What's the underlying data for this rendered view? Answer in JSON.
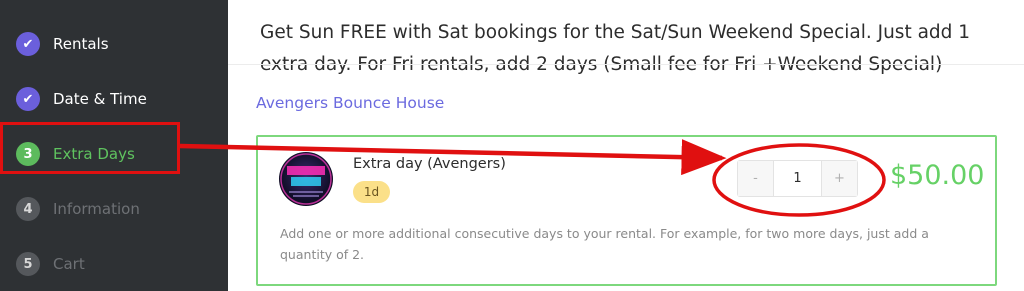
{
  "sidebar": {
    "steps": [
      {
        "number": "✔",
        "label": "Rentals",
        "state": "done"
      },
      {
        "number": "✔",
        "label": "Date & Time",
        "state": "done"
      },
      {
        "number": "3",
        "label": "Extra Days",
        "state": "current"
      },
      {
        "number": "4",
        "label": "Information",
        "state": "todo"
      },
      {
        "number": "5",
        "label": "Cart",
        "state": "todo"
      }
    ]
  },
  "main": {
    "promo_text": "Get Sun FREE with Sat bookings for the Sat/Sun Weekend Special. Just add 1 extra day. For Fri rentals, add 2 days (Small fee for Fri +Weekend Special)",
    "product_title": "Avengers Bounce House",
    "item": {
      "thumbnail_text": "EXTEND 1 DAY",
      "name": "Extra day (Avengers)",
      "badge": "1d",
      "quantity": "1",
      "decrement_label": "-",
      "increment_label": "+",
      "price": "$50.00",
      "description": "Add one or more additional consecutive days to your rental. For example, for two more days, just add a quantity of 2."
    }
  },
  "colors": {
    "sidebar_bg": "#2e3134",
    "step_done": "#6b5fdc",
    "step_current": "#5dbb5d",
    "annotation_red": "#e01010",
    "price_green": "#66d166"
  }
}
